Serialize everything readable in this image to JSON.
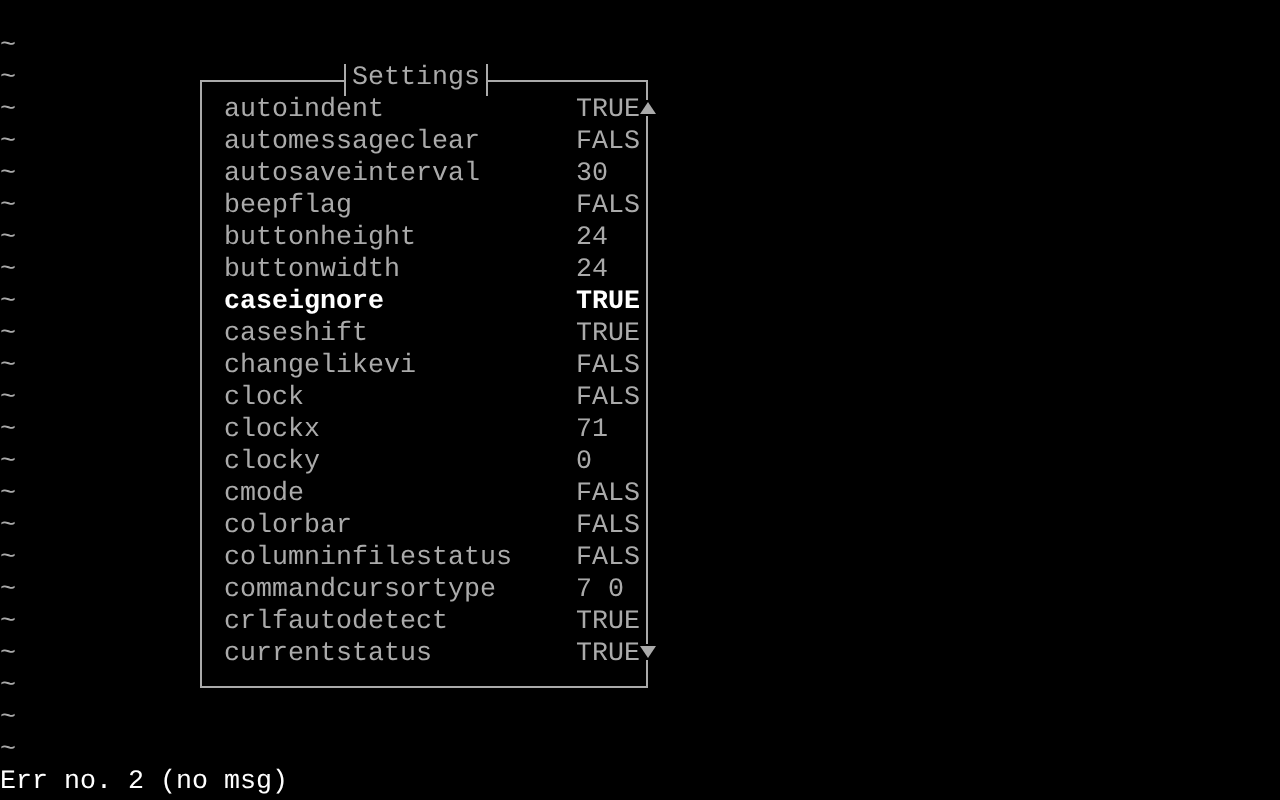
{
  "editor": {
    "empty_lines": [
      "~",
      "~",
      "~",
      "~",
      "~",
      "~",
      "~",
      "~",
      "~",
      "~",
      "~",
      "~",
      "~",
      "~",
      "~",
      "~",
      "~",
      "~",
      "~",
      "~",
      "~",
      "~",
      "~"
    ]
  },
  "settings_dialog": {
    "title": "Settings",
    "items": [
      {
        "name": "autoindent",
        "value": "TRUE",
        "selected": false
      },
      {
        "name": "automessageclear",
        "value": "FALS",
        "selected": false
      },
      {
        "name": "autosaveinterval",
        "value": "30",
        "selected": false
      },
      {
        "name": "beepflag",
        "value": "FALS",
        "selected": false
      },
      {
        "name": "buttonheight",
        "value": "24",
        "selected": false
      },
      {
        "name": "buttonwidth",
        "value": "24",
        "selected": false
      },
      {
        "name": "caseignore",
        "value": "TRUE",
        "selected": true
      },
      {
        "name": "caseshift",
        "value": "TRUE",
        "selected": false
      },
      {
        "name": "changelikevi",
        "value": "FALS",
        "selected": false
      },
      {
        "name": "clock",
        "value": "FALS",
        "selected": false
      },
      {
        "name": "clockx",
        "value": "71",
        "selected": false
      },
      {
        "name": "clocky",
        "value": "0",
        "selected": false
      },
      {
        "name": "cmode",
        "value": "FALS",
        "selected": false
      },
      {
        "name": "colorbar",
        "value": "FALS",
        "selected": false
      },
      {
        "name": "columninfilestatus",
        "value": "FALS",
        "selected": false
      },
      {
        "name": "commandcursortype",
        "value": "7 0",
        "selected": false
      },
      {
        "name": "crlfautodetect",
        "value": "TRUE",
        "selected": false
      },
      {
        "name": "currentstatus",
        "value": "TRUE",
        "selected": false
      }
    ]
  },
  "status_line": "Err no. 2 (no msg)"
}
